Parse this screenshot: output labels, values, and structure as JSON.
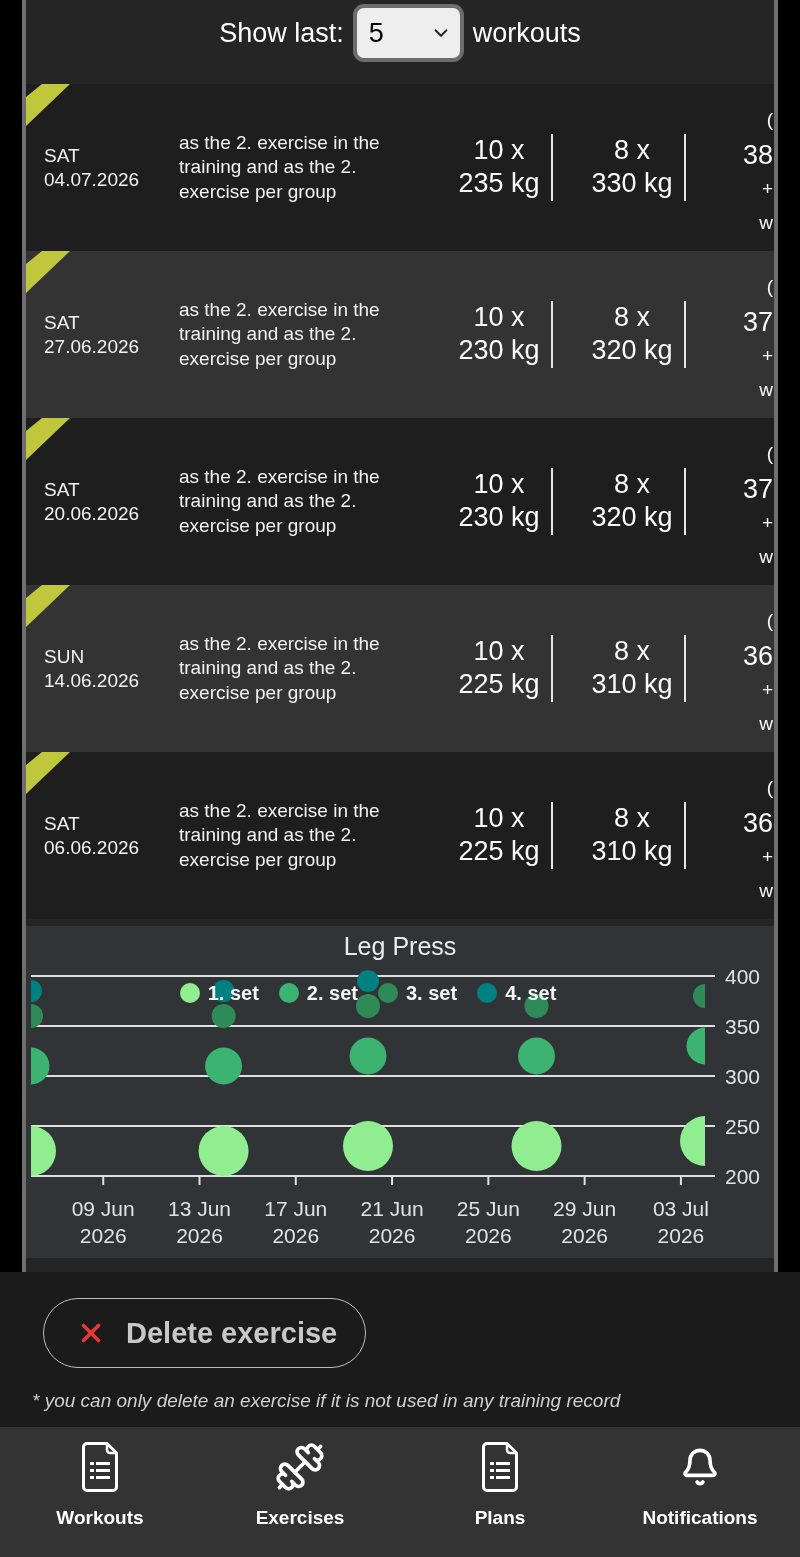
{
  "show_last": {
    "label": "Show last:",
    "value": "5",
    "suffix": "workouts"
  },
  "workouts": [
    {
      "weekday": "SAT",
      "date": "04.07.2026",
      "description": "as the 2. exercise in the training and as the 2. exercise per group",
      "sets": [
        {
          "reps": "10 x",
          "weight": "235 kg"
        },
        {
          "reps": "8 x",
          "weight": "330 kg"
        }
      ],
      "column_3": [
        "(",
        "38",
        "+",
        "w"
      ]
    },
    {
      "weekday": "SAT",
      "date": "27.06.2026",
      "description": "as the 2. exercise in the training and as the 2. exercise per group",
      "sets": [
        {
          "reps": "10 x",
          "weight": "230 kg"
        },
        {
          "reps": "8 x",
          "weight": "320 kg"
        }
      ],
      "column_3": [
        "(",
        "37",
        "+",
        "w"
      ]
    },
    {
      "weekday": "SAT",
      "date": "20.06.2026",
      "description": "as the 2. exercise in the training and as the 2. exercise per group",
      "sets": [
        {
          "reps": "10 x",
          "weight": "230 kg"
        },
        {
          "reps": "8 x",
          "weight": "320 kg"
        }
      ],
      "column_3": [
        "(",
        "37",
        "+",
        "w"
      ]
    },
    {
      "weekday": "SUN",
      "date": "14.06.2026",
      "description": "as the 2. exercise in the training and as the 2. exercise per group",
      "sets": [
        {
          "reps": "10 x",
          "weight": "225 kg"
        },
        {
          "reps": "8 x",
          "weight": "310 kg"
        }
      ],
      "column_3": [
        "(",
        "36",
        "+",
        "w"
      ]
    },
    {
      "weekday": "SAT",
      "date": "06.06.2026",
      "description": "as the 2. exercise in the training and as the 2. exercise per group",
      "sets": [
        {
          "reps": "10 x",
          "weight": "225 kg"
        },
        {
          "reps": "8 x",
          "weight": "310 kg"
        }
      ],
      "column_3": [
        "(",
        "36",
        "+",
        "w"
      ]
    }
  ],
  "chart": {
    "chart_data": {
      "type": "scatter",
      "title": "Leg Press",
      "x": [
        "2026-06-06",
        "2026-06-14",
        "2026-06-20",
        "2026-06-27",
        "2026-07-04"
      ],
      "series": [
        {
          "name": "1. set",
          "color": "#90ee90",
          "values": [
            225,
            225,
            230,
            230,
            235
          ]
        },
        {
          "name": "2. set",
          "color": "#3cb371",
          "values": [
            310,
            310,
            320,
            320,
            330
          ]
        },
        {
          "name": "3. set",
          "color": "#2e8b57",
          "values": [
            360,
            360,
            370,
            370,
            380
          ]
        },
        {
          "name": "4. set",
          "color": "#008080",
          "values": [
            385,
            385,
            395,
            null,
            null
          ]
        }
      ],
      "xlim": [
        "2026-06-06",
        "2026-07-04"
      ],
      "ylim": [
        200,
        400
      ],
      "xticks": [
        {
          "value": "2026-06-09",
          "label": "09 Jun 2026"
        },
        {
          "value": "2026-06-13",
          "label": "13 Jun 2026"
        },
        {
          "value": "2026-06-17",
          "label": "17 Jun 2026"
        },
        {
          "value": "2026-06-21",
          "label": "21 Jun 2026"
        },
        {
          "value": "2026-06-25",
          "label": "25 Jun 2026"
        },
        {
          "value": "2026-06-29",
          "label": "29 Jun 2026"
        },
        {
          "value": "2026-07-03",
          "label": "03 Jul 2026"
        }
      ],
      "yticks": [
        200,
        250,
        300,
        350,
        400
      ],
      "grid": true,
      "legend": "top"
    }
  },
  "delete_button": {
    "label": "Delete exercise"
  },
  "note": "* you can only delete an exercise if it is not used in any training record",
  "bottom_nav": [
    {
      "label": "Workouts"
    },
    {
      "label": "Exercises"
    },
    {
      "label": "Plans"
    },
    {
      "label": "Notifications"
    }
  ]
}
